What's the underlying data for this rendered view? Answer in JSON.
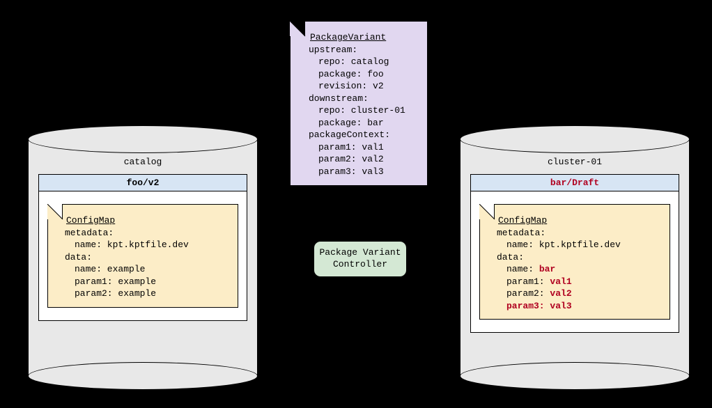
{
  "left_repo": {
    "label": "catalog",
    "package_title": "foo/v2",
    "configmap": {
      "title": "ConfigMap",
      "l1": "metadata:",
      "l2": "name: kpt.kptfile.dev",
      "l3": "data:",
      "l4": "name: example",
      "l5": "param1: example",
      "l6": "param2: example"
    }
  },
  "right_repo": {
    "label": "cluster-01",
    "package_title": "bar/Draft",
    "configmap": {
      "title": "ConfigMap",
      "l1": "metadata:",
      "l2": "name: kpt.kptfile.dev",
      "l3": "data:",
      "l4a": "name: ",
      "l4b": "bar",
      "l5a": "param1: ",
      "l5b": "val1",
      "l6a": "param2: ",
      "l6b": "val2",
      "l7": "param3: val3"
    }
  },
  "package_variant": {
    "title": "PackageVariant",
    "l1": "upstream:",
    "l2": "repo: catalog",
    "l3": "package: foo",
    "l4": "revision: v2",
    "l5": "downstream:",
    "l6": "repo: cluster-01",
    "l7": "package: bar",
    "l8": "packageContext:",
    "l9": "param1: val1",
    "l10": "param2: val2",
    "l11": "param3: val3"
  },
  "controller": {
    "line1": "Package Variant",
    "line2": "Controller"
  }
}
